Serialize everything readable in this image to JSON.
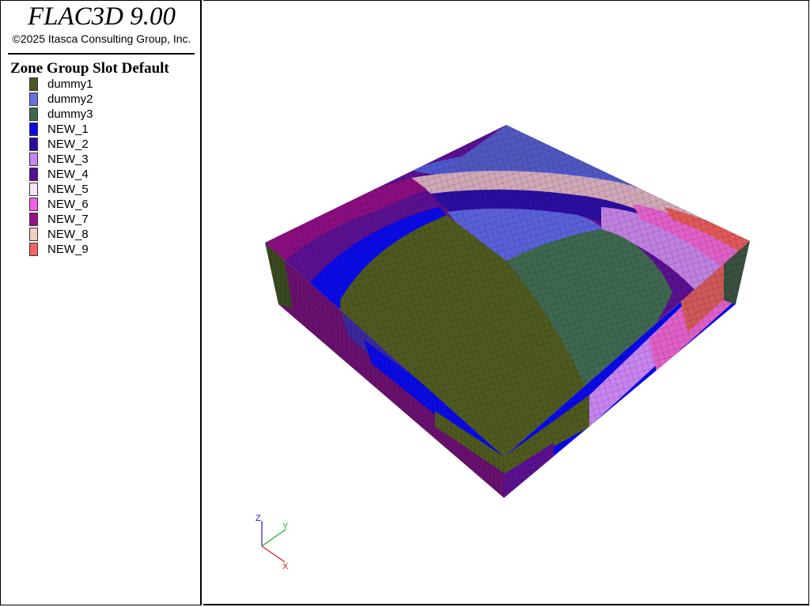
{
  "app": {
    "title": "FLAC3D 9.00",
    "copyright": "©2025 Itasca Consulting Group, Inc."
  },
  "legend": {
    "heading": "Zone Group Slot Default",
    "items": [
      {
        "label": "dummy1",
        "color": "#4e5a20"
      },
      {
        "label": "dummy2",
        "color": "#6670e0"
      },
      {
        "label": "dummy3",
        "color": "#3f6850"
      },
      {
        "label": "NEW_1",
        "color": "#0a0ae6"
      },
      {
        "label": "NEW_2",
        "color": "#2a0ea0"
      },
      {
        "label": "NEW_3",
        "color": "#c884f0"
      },
      {
        "label": "NEW_4",
        "color": "#5a0c94"
      },
      {
        "label": "NEW_5",
        "color": "#f8e2f8"
      },
      {
        "label": "NEW_6",
        "color": "#f060e8"
      },
      {
        "label": "NEW_7",
        "color": "#9a0e88"
      },
      {
        "label": "NEW_8",
        "color": "#f4cec0"
      },
      {
        "label": "NEW_9",
        "color": "#f26464"
      }
    ]
  },
  "axes": {
    "z": "Z",
    "y": "Y",
    "x": "X"
  }
}
